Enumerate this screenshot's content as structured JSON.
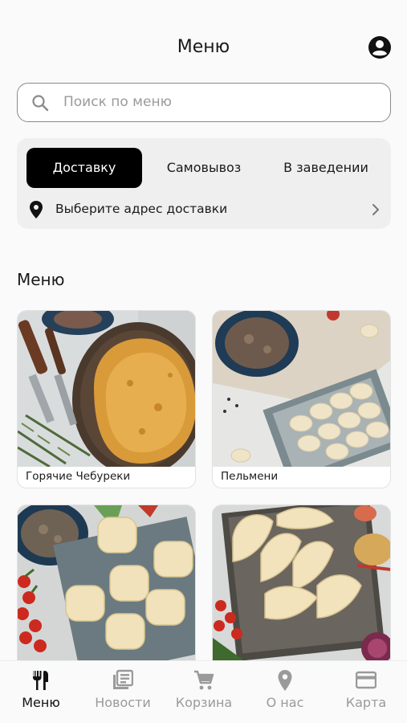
{
  "header": {
    "title": "Меню",
    "profile_icon": "account-circle-icon"
  },
  "search": {
    "placeholder": "Поиск по меню",
    "value": "",
    "icon": "search-icon"
  },
  "delivery": {
    "modes": [
      {
        "label": "Доставку",
        "active": true
      },
      {
        "label": "Самовывоз",
        "active": false
      },
      {
        "label": "В заведении",
        "active": false
      }
    ],
    "address_label": "Выберите адрес доставки",
    "address_icon": "location-pin-icon"
  },
  "menu": {
    "title": "Меню",
    "categories": [
      {
        "label": "Горячие Чебуреки"
      },
      {
        "label": "Пельмени"
      },
      {
        "label": ""
      },
      {
        "label": ""
      }
    ]
  },
  "tabbar": {
    "items": [
      {
        "label": "Меню",
        "icon": "fork-knife-icon",
        "active": true
      },
      {
        "label": "Новости",
        "icon": "news-icon",
        "active": false
      },
      {
        "label": "Корзина",
        "icon": "cart-icon",
        "active": false
      },
      {
        "label": "О нас",
        "icon": "location-pin-icon",
        "active": false
      },
      {
        "label": "Карта",
        "icon": "credit-card-icon",
        "active": false
      }
    ]
  },
  "colors": {
    "accent": "#000000",
    "inactive": "#9a9a9a",
    "card_bg": "#efefef"
  }
}
